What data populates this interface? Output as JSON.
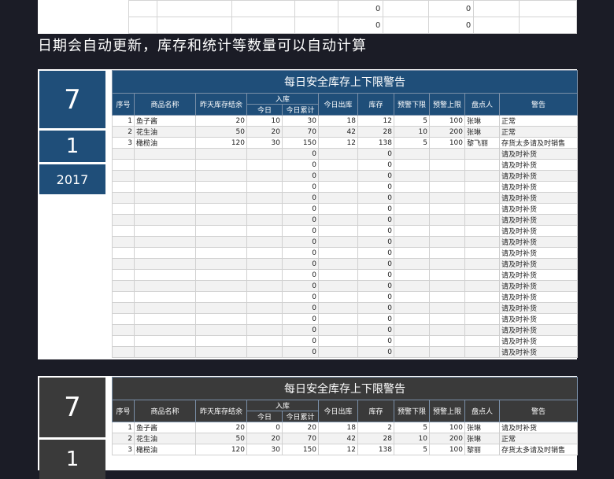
{
  "top_fragment": {
    "rows": [
      [
        "",
        "",
        "",
        "",
        "0",
        "",
        "0",
        "",
        ""
      ],
      [
        "",
        "",
        "",
        "",
        "0",
        "",
        "0",
        "",
        ""
      ]
    ]
  },
  "caption": "日期会自动更新，库存和统计等数量可以自动计算",
  "headers": {
    "title": "每日安全库存上下限警告",
    "no": "序号",
    "name": "商品名称",
    "yesterday": "昨天库存结余",
    "inbound": "入库",
    "today": "今日",
    "today_total": "今日累计",
    "outbound": "今日出库",
    "stock": "库存",
    "lower": "预警下限",
    "upper": "预警上限",
    "checker": "盘点人",
    "warning": "警告"
  },
  "tables": [
    {
      "color": "#1f4e79",
      "month": "7",
      "day": "1",
      "year": "2017",
      "rows": [
        [
          "1",
          "鱼子酱",
          "20",
          "10",
          "30",
          "18",
          "12",
          "5",
          "100",
          "张琳",
          "正常"
        ],
        [
          "2",
          "花生油",
          "50",
          "20",
          "70",
          "42",
          "28",
          "10",
          "200",
          "张琳",
          "正常"
        ],
        [
          "3",
          "橄榄油",
          "120",
          "30",
          "150",
          "12",
          "138",
          "5",
          "100",
          "黎飞丽",
          "存货太多请及时销售"
        ]
      ],
      "blank_rows": {
        "count": 19,
        "today_total": "0",
        "stock": "0",
        "warning": "请及时补货"
      }
    },
    {
      "color": "#3a3a3a",
      "month": "7",
      "day": "1",
      "rows": [
        [
          "1",
          "鱼子酱",
          "20",
          "0",
          "20",
          "18",
          "2",
          "5",
          "100",
          "张琳",
          "请及时补货"
        ],
        [
          "2",
          "花生油",
          "50",
          "20",
          "70",
          "42",
          "28",
          "10",
          "200",
          "张琳",
          "正常"
        ],
        [
          "3",
          "橄榄油",
          "120",
          "30",
          "150",
          "12",
          "138",
          "5",
          "100",
          "黎丽",
          "存货太多请及时销售"
        ]
      ]
    }
  ]
}
